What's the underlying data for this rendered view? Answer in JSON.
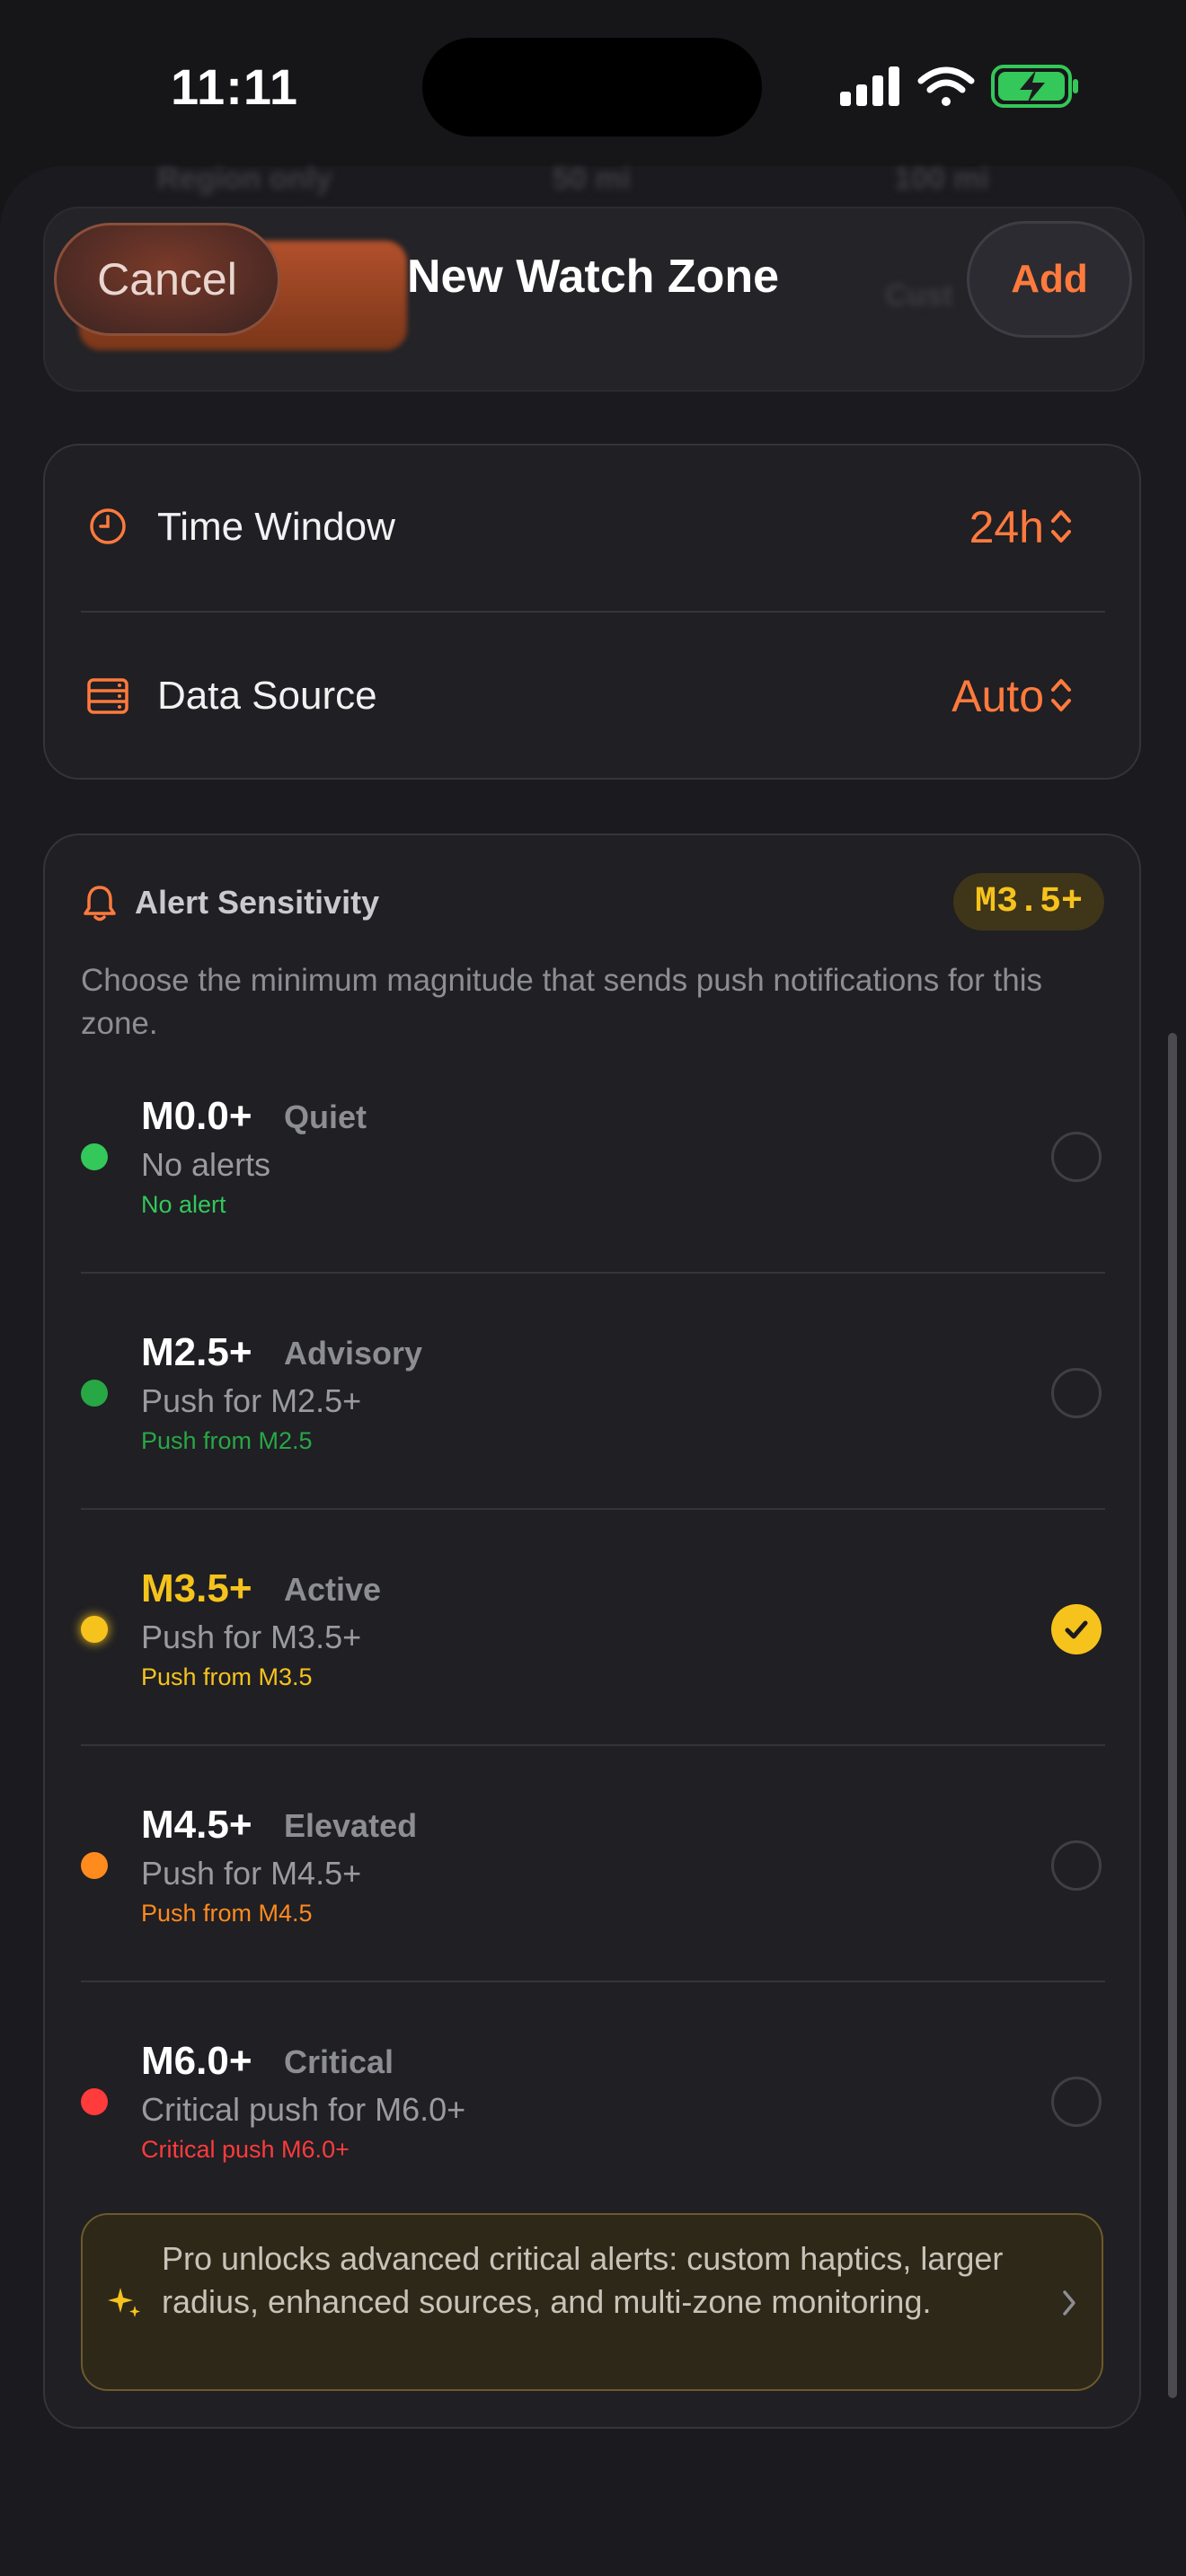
{
  "status_bar": {
    "time": "11:11"
  },
  "header": {
    "cancel_label": "Cancel",
    "title": "New Watch Zone",
    "add_label": "Add"
  },
  "background_remnants": [
    "Region only",
    "50 mi",
    "100 mi",
    "Cust"
  ],
  "settings": {
    "time_window": {
      "label": "Time Window",
      "value": "24h"
    },
    "data_source": {
      "label": "Data Source",
      "value": "Auto"
    }
  },
  "alert_sensitivity": {
    "title": "Alert Sensitivity",
    "badge": "M3.5+",
    "description": "Choose the minimum magnitude that sends push notifications for this zone.",
    "selected": "M3.5+",
    "options": [
      {
        "magnitude": "M0.0+",
        "name": "Quiet",
        "subtitle": "No alerts",
        "tag": "No alert",
        "color": "#34c759",
        "selected": false
      },
      {
        "magnitude": "M2.5+",
        "name": "Advisory",
        "subtitle": "Push for M2.5+",
        "tag": "Push from M2.5",
        "color": "#28a745",
        "selected": false
      },
      {
        "magnitude": "M3.5+",
        "name": "Active",
        "subtitle": "Push for M3.5+",
        "tag": "Push from M3.5",
        "color": "#f6c31c",
        "selected": true
      },
      {
        "magnitude": "M4.5+",
        "name": "Elevated",
        "subtitle": "Push for M4.5+",
        "tag": "Push from M4.5",
        "color": "#ff8a1e",
        "selected": false
      },
      {
        "magnitude": "M6.0+",
        "name": "Critical",
        "subtitle": "Critical push for M6.0+",
        "tag": "Critical push M6.0+",
        "color": "#ff3b3b",
        "selected": false
      }
    ]
  },
  "pro_banner": {
    "text": "Pro unlocks advanced critical alerts: custom haptics, larger radius, enhanced sources, and multi-zone monitoring."
  },
  "icons": {
    "clock": "clock-icon",
    "data_source": "server-icon",
    "bell": "bell-icon",
    "sparkle": "sparkles-icon",
    "chevron": "chevron-right-icon",
    "updown": "chevron-up-down-icon",
    "checkmark": "checkmark-icon"
  },
  "colors": {
    "accent": "#ff7a3c",
    "selected": "#f6c31c",
    "background": "#161619",
    "card": "#1f1f24"
  }
}
